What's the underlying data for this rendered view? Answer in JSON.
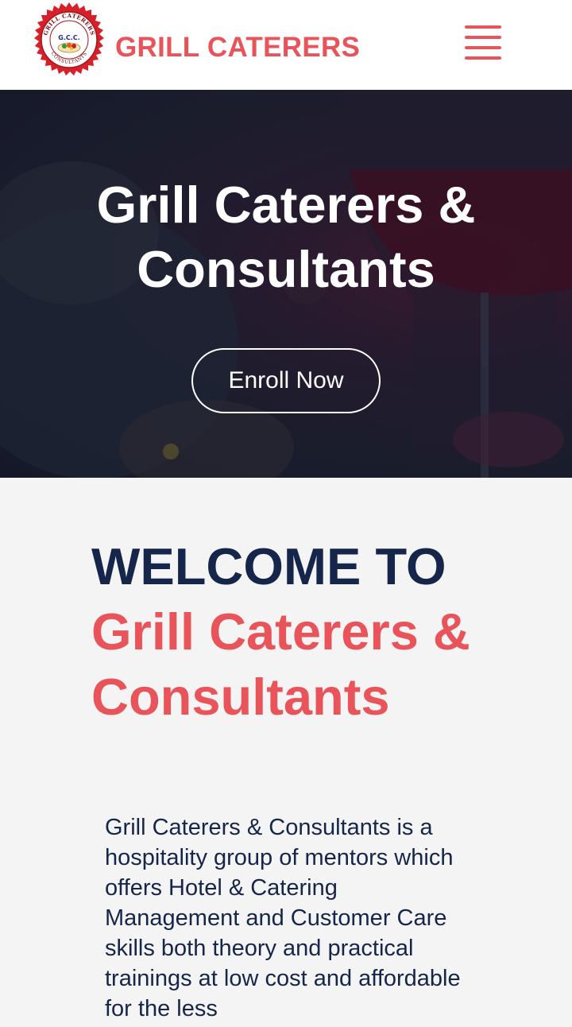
{
  "header": {
    "brand": "GRILL CATERERS",
    "logo": {
      "top_text": "GRILL CATERERS",
      "center_text": "G.C.C.",
      "bottom_text": "CONSULTANTS"
    },
    "menu_icon": "hamburger-menu-icon"
  },
  "hero": {
    "title": "Grill Caterers & Consultants",
    "enroll_button": "Enroll Now"
  },
  "welcome": {
    "line1": "WELCOME TO",
    "line2": "Grill Caterers &",
    "line3": "Consultants"
  },
  "about": {
    "text": "Grill Caterers & Consultants is a hospitality group of mentors which offers Hotel & Catering Management and Customer Care skills both theory and practical trainings at low cost and affordable for the less"
  },
  "colors": {
    "accent": "#e8545a",
    "navy": "#16264a",
    "background": "#f4f4f4"
  }
}
